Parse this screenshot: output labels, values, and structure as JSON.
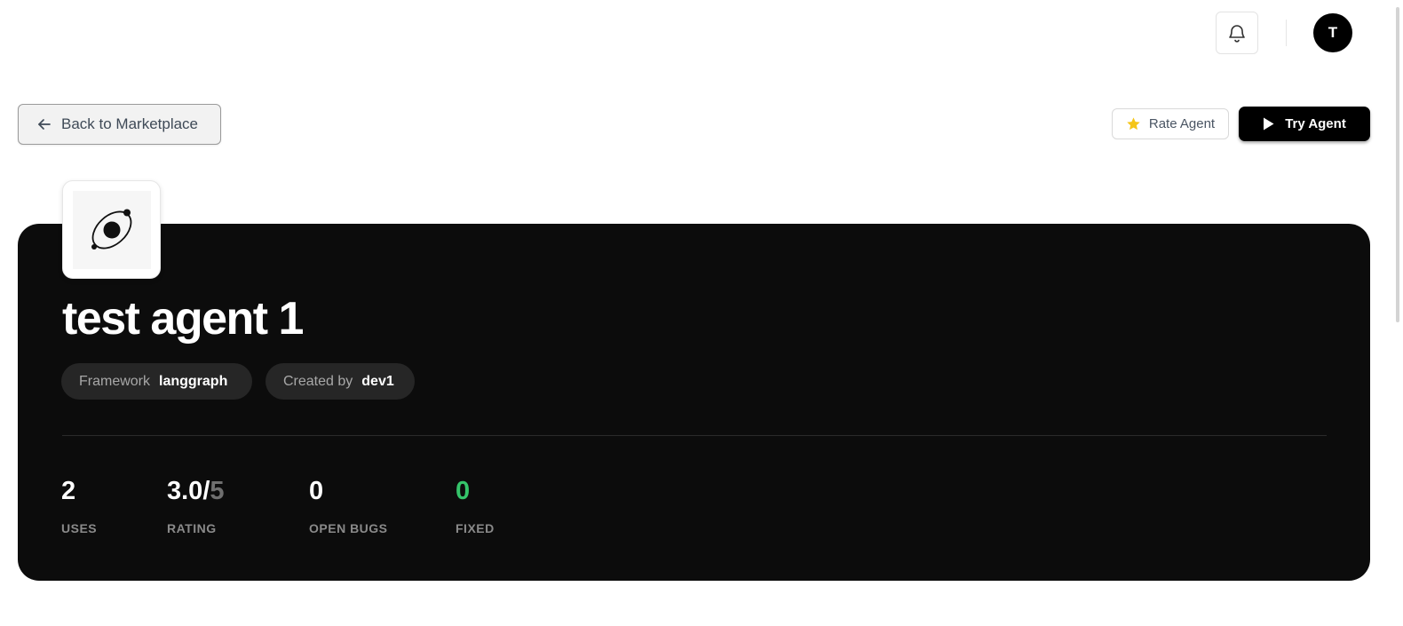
{
  "header": {
    "notifications_icon": "bell-icon",
    "avatar_initial": "T"
  },
  "nav": {
    "back_label": "Back to Marketplace",
    "back_icon": "arrow-left-icon"
  },
  "actions": {
    "rate_label": "Rate Agent",
    "rate_icon": "star-icon",
    "try_label": "Try Agent",
    "try_icon": "play-icon"
  },
  "agent": {
    "name": "test agent 1",
    "logo_icon": "orbit-icon",
    "framework_key": "Framework",
    "framework_value": "langgraph",
    "creator_key": "Created by",
    "creator_value": "dev1"
  },
  "stats": {
    "uses": {
      "value": "2",
      "label": "USES"
    },
    "rating": {
      "value": "3.0",
      "separator": "/",
      "max": "5",
      "label": "RATING"
    },
    "open_bugs": {
      "value": "0",
      "label": "OPEN BUGS"
    },
    "fixed": {
      "value": "0",
      "label": "FIXED"
    }
  },
  "colors": {
    "hero_bg": "#0c0c0c",
    "star": "#f5c518",
    "fixed_green": "#35c46a"
  }
}
